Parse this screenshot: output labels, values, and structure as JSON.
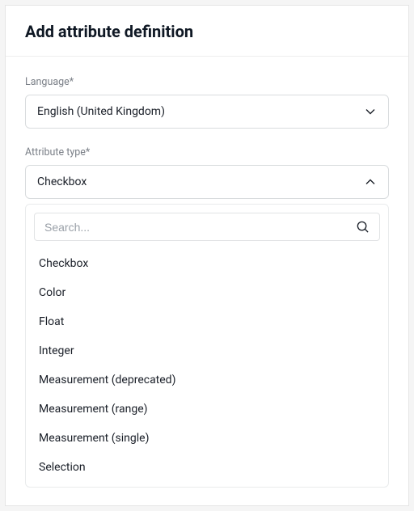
{
  "header": {
    "title": "Add attribute definition"
  },
  "language": {
    "label": "Language*",
    "value": "English (United Kingdom)"
  },
  "attributeType": {
    "label": "Attribute type*",
    "value": "Checkbox",
    "searchPlaceholder": "Search...",
    "options": [
      "Checkbox",
      "Color",
      "Float",
      "Integer",
      "Measurement (deprecated)",
      "Measurement (range)",
      "Measurement (single)",
      "Selection"
    ]
  }
}
